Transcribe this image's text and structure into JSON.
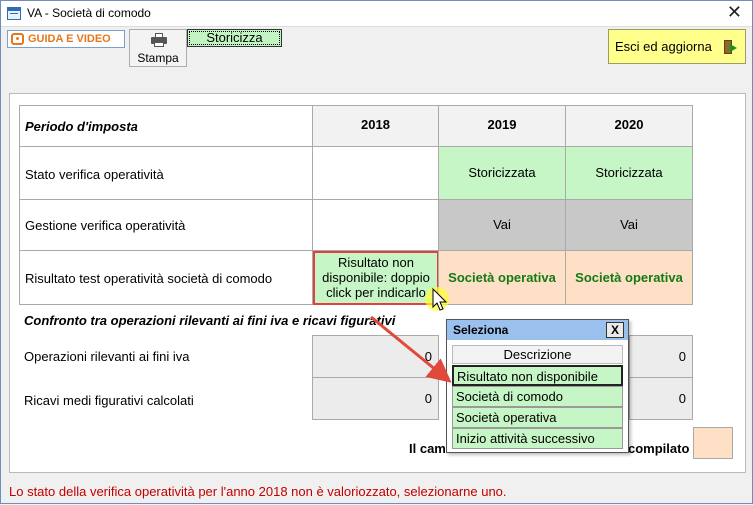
{
  "window": {
    "title": "VA - Società di comodo",
    "close_glyph": "✕"
  },
  "toolbar": {
    "guida_label": "GUIDA E VIDEO",
    "stampa_label": "Stampa",
    "storicizza_label": "Storicizza",
    "esci_label": "Esci ed aggiorna"
  },
  "table": {
    "periodo_label": "Periodo d'imposta",
    "years": [
      "2018",
      "2019",
      "2020"
    ],
    "rows": {
      "stato": {
        "label": "Stato verifica operatività",
        "values": [
          "",
          "Storicizzata",
          "Storicizzata"
        ]
      },
      "gestione": {
        "label": "Gestione verifica operatività",
        "values": [
          "",
          "Vai",
          "Vai"
        ]
      },
      "risultato": {
        "label": "Risultato test operatività società di comodo",
        "values": [
          "Risultato non disponibile: doppio click per indicarlo",
          "Società operativa",
          "Società operativa"
        ]
      }
    },
    "confronto_label": "Confronto tra operazioni rilevanti ai fini iva e ricavi figurativi",
    "operazioni": {
      "label": "Operazioni rilevanti ai fini iva",
      "values": [
        "0",
        "0"
      ]
    },
    "ricavi": {
      "label": "Ricavi medi figurativi calcolati",
      "values": [
        "0",
        "0"
      ]
    },
    "campo_left": "Il cam",
    "campo_right": "compilato"
  },
  "popup": {
    "title": "Seleziona",
    "close_label": "X",
    "header": "Descrizione",
    "items": [
      "Risultato non disponibile",
      "Società di comodo",
      "Società operativa",
      "Inizio attività successivo"
    ]
  },
  "status": {
    "message": "Lo stato della verifica operatività per l'anno 2018 non è valoriozzato, selezionarne uno."
  },
  "colors": {
    "green": "#c6f5c6",
    "peach": "#fde0c5",
    "gray": "#c8c8c8",
    "yellow": "#ffff8c",
    "status_red": "#c00000",
    "popup_title": "#9ac0ee"
  }
}
